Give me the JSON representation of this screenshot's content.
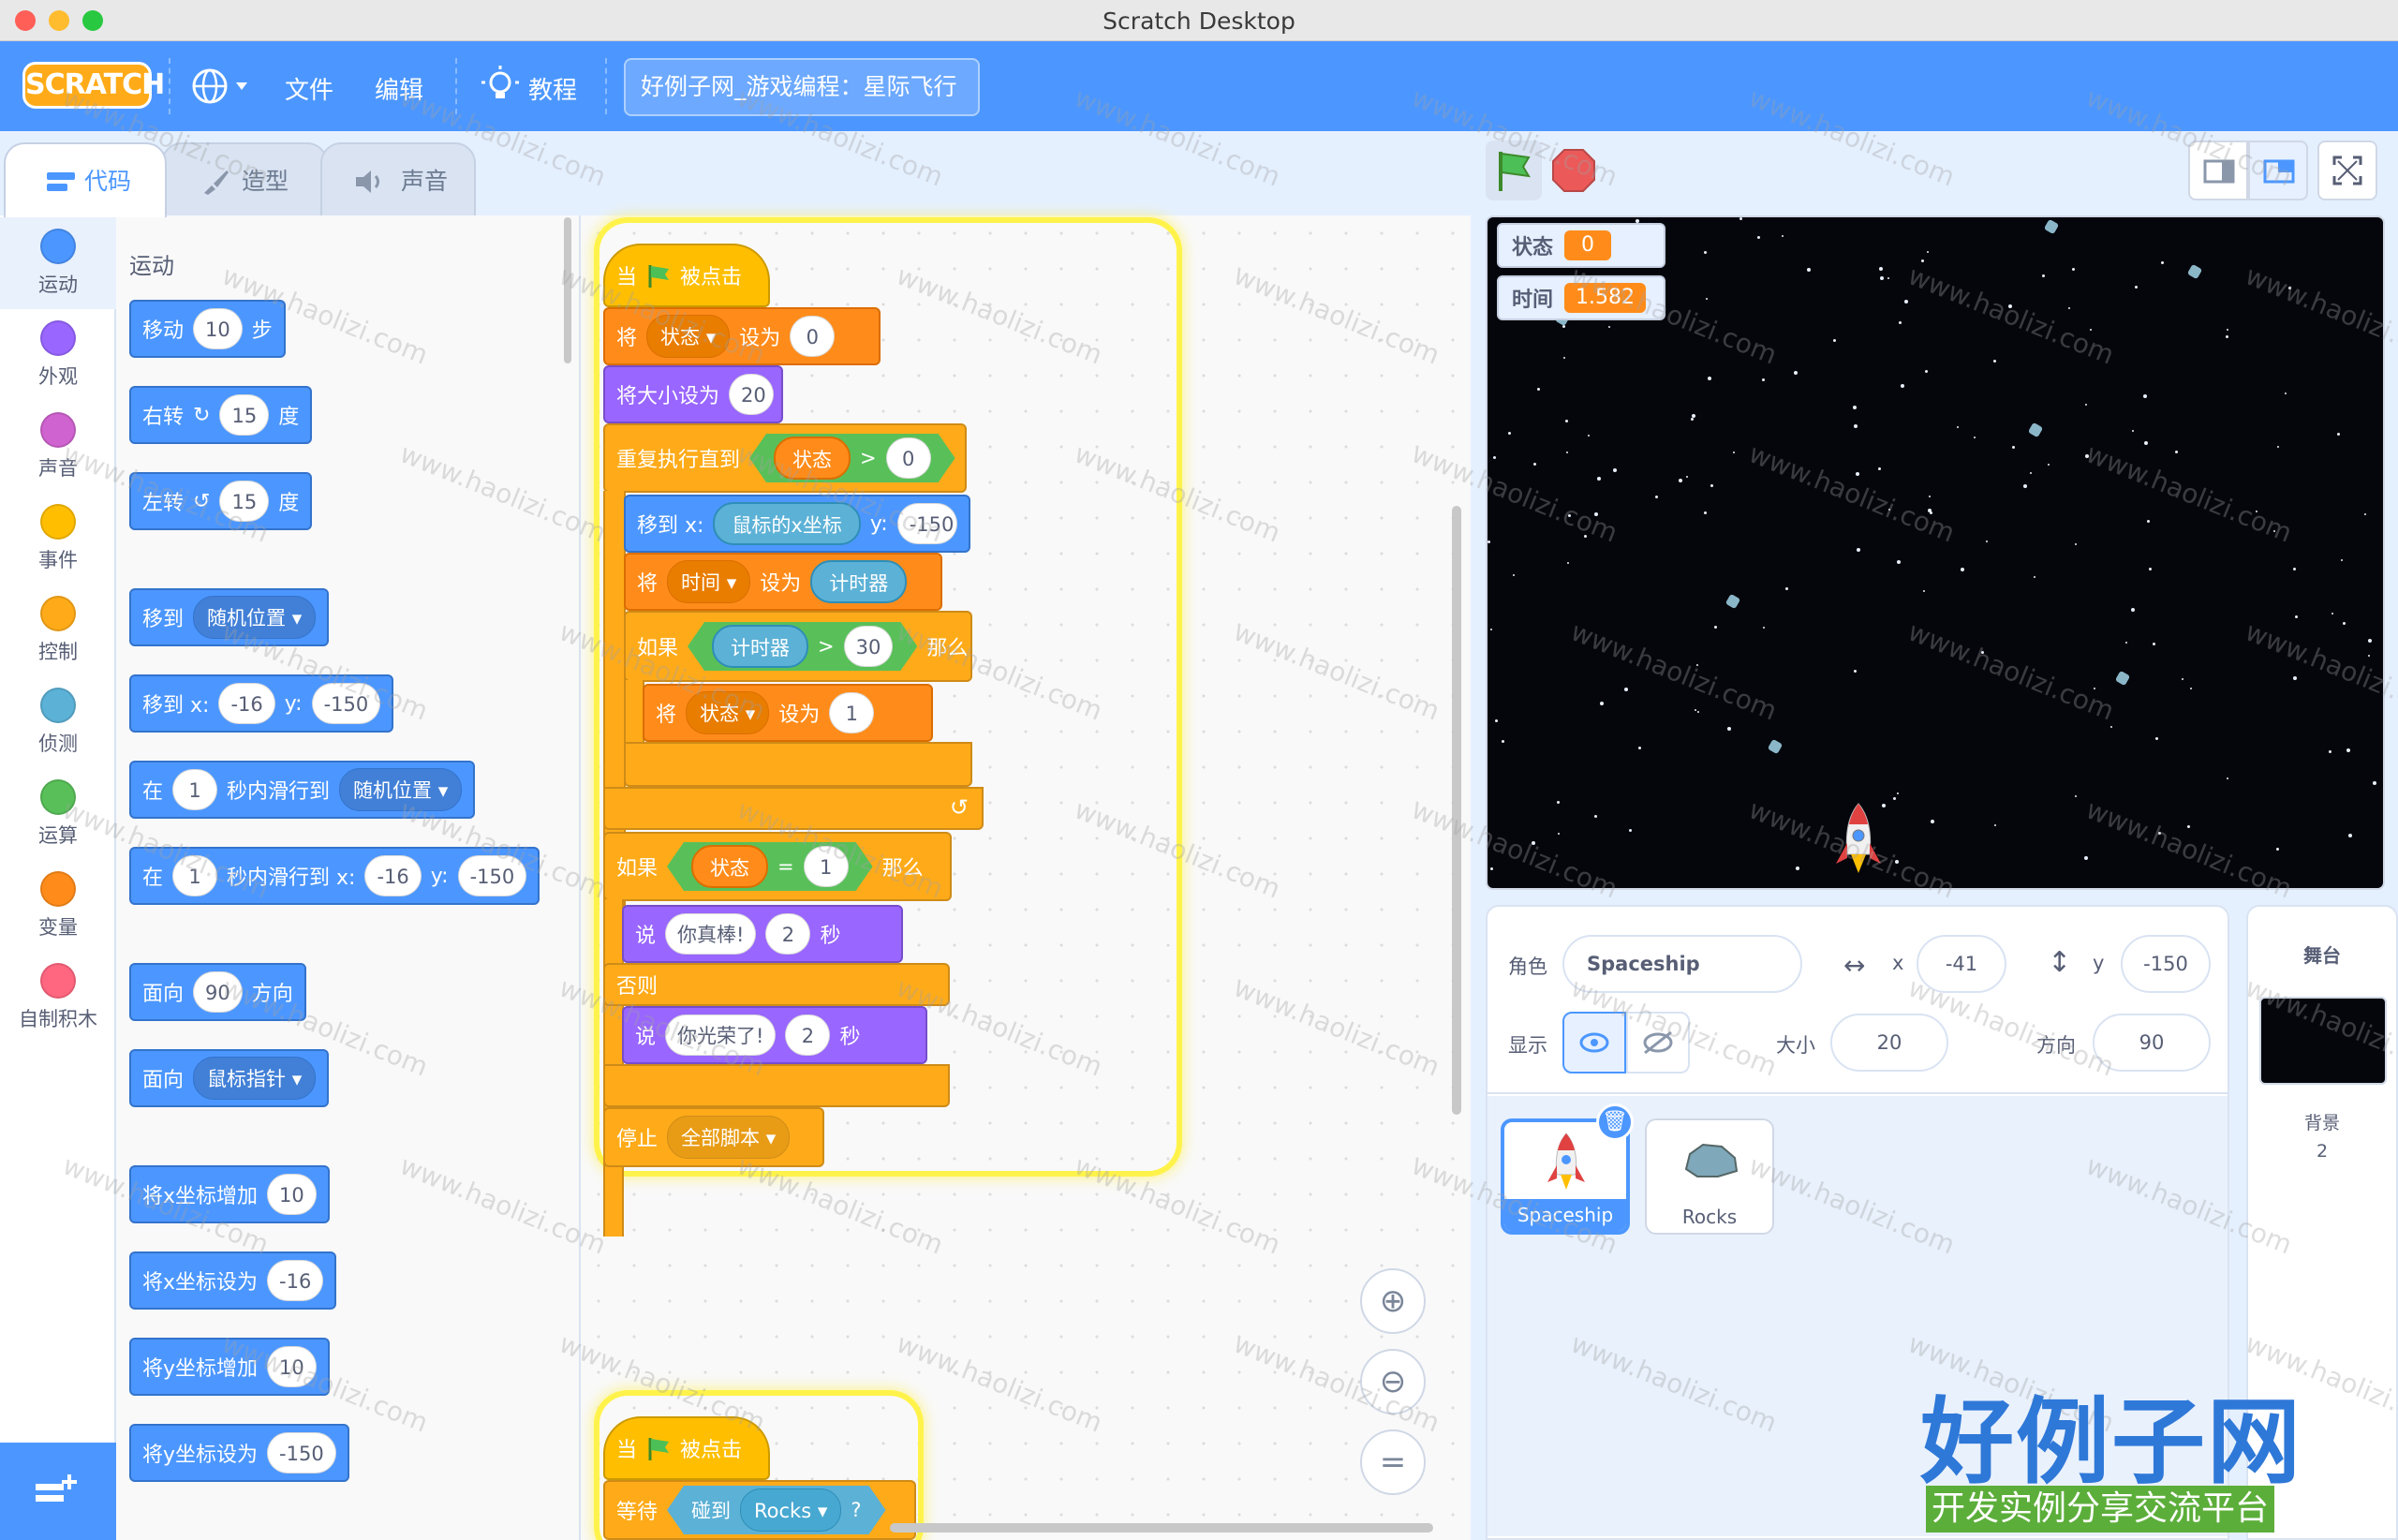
{
  "window": {
    "title": "Scratch Desktop"
  },
  "menubar": {
    "logo": "SCRATCH",
    "file": "文件",
    "edit": "编辑",
    "tutorials": "教程",
    "project_title": "好例子网_游戏编程：星际飞行",
    "accent": "#4c97ff"
  },
  "tabs": [
    {
      "label": "代码",
      "icon": "code-icon"
    },
    {
      "label": "造型",
      "icon": "brush-icon"
    },
    {
      "label": "声音",
      "icon": "speaker-icon"
    }
  ],
  "categories": [
    {
      "label": "运动",
      "color": "#4c97ff"
    },
    {
      "label": "外观",
      "color": "#9966ff"
    },
    {
      "label": "声音",
      "color": "#cf63cf"
    },
    {
      "label": "事件",
      "color": "#ffbf00"
    },
    {
      "label": "控制",
      "color": "#ffab19"
    },
    {
      "label": "侦测",
      "color": "#5cb1d6"
    },
    {
      "label": "运算",
      "color": "#59c059"
    },
    {
      "label": "变量",
      "color": "#ff8c1a"
    },
    {
      "label": "自制积木",
      "color": "#ff6680"
    }
  ],
  "palette": {
    "heading": "运动",
    "move": {
      "a": "移动",
      "v": "10",
      "b": "步"
    },
    "turn_right": {
      "a": "右转",
      "v": "15",
      "b": "度"
    },
    "turn_left": {
      "a": "左转",
      "v": "15",
      "b": "度"
    },
    "goto": {
      "a": "移到",
      "dd": "随机位置"
    },
    "goto_xy": {
      "a": "移到 x:",
      "x": "-16",
      "b": "y:",
      "y": "-150"
    },
    "glide": {
      "a": "在",
      "v": "1",
      "b": "秒内滑行到",
      "dd": "随机位置"
    },
    "glide_xy": {
      "a": "在",
      "v": "1",
      "b": "秒内滑行到 x:",
      "x": "-16",
      "c": "y:",
      "y": "-150"
    },
    "point_dir": {
      "a": "面向",
      "v": "90",
      "b": "方向"
    },
    "point_towards": {
      "a": "面向",
      "dd": "鼠标指针"
    },
    "change_x": {
      "a": "将x坐标增加",
      "v": "10"
    },
    "set_x": {
      "a": "将x坐标设为",
      "v": "-16"
    },
    "change_y": {
      "a": "将y坐标增加",
      "v": "10"
    },
    "set_y": {
      "a": "将y坐标设为",
      "v": "-150"
    }
  },
  "script1": {
    "hat": {
      "a": "当",
      "b": "被点击"
    },
    "set_state": {
      "a": "将",
      "var": "状态",
      "b": "设为",
      "v": "0"
    },
    "set_size": {
      "a": "将大小设为",
      "v": "20"
    },
    "repeat_until": {
      "a": "重复执行直到",
      "var": "状态",
      "op": ">",
      "v": "0"
    },
    "goto_xy": {
      "a": "移到 x:",
      "rep": "鼠标的x坐标",
      "b": "y:",
      "y": "-150"
    },
    "set_time": {
      "a": "将",
      "var": "时间",
      "b": "设为",
      "rep": "计时器"
    },
    "if_timer": {
      "a": "如果",
      "rep": "计时器",
      "op": ">",
      "v": "30",
      "b": "那么"
    },
    "set_state1": {
      "a": "将",
      "var": "状态",
      "b": "设为",
      "v": "1"
    },
    "if_state": {
      "a": "如果",
      "var": "状态",
      "op": "=",
      "v": "1",
      "b": "那么"
    },
    "say1": {
      "a": "说",
      "text": "你真棒!",
      "v": "2",
      "b": "秒"
    },
    "else": "否则",
    "say2": {
      "a": "说",
      "text": "你光荣了!",
      "v": "2",
      "b": "秒"
    },
    "stop": {
      "a": "停止",
      "dd": "全部脚本"
    }
  },
  "script2": {
    "hat": {
      "a": "当",
      "b": "被点击"
    },
    "wait": {
      "a": "等待",
      "b": "碰到",
      "dd": "Rocks",
      "c": "?"
    }
  },
  "stage": {
    "monitors": [
      {
        "label": "状态",
        "value": "0"
      },
      {
        "label": "时间",
        "value": "1.582"
      }
    ]
  },
  "sprite_info": {
    "sprite_label": "角色",
    "sprite_name": "Spaceship",
    "x_label": "x",
    "x": "-41",
    "y_label": "y",
    "y": "-150",
    "show_label": "显示",
    "size_label": "大小",
    "size": "20",
    "direction_label": "方向",
    "direction": "90"
  },
  "sprites": [
    {
      "name": "Spaceship",
      "selected": true
    },
    {
      "name": "Rocks",
      "selected": false
    }
  ],
  "stage_pane": {
    "title": "舞台",
    "backdrop_label": "背景",
    "backdrop_count": "2"
  },
  "watermark": {
    "text": "www.haolizi.com",
    "big_title": "好例子网",
    "big_sub": "开发实例分享交流平台"
  }
}
